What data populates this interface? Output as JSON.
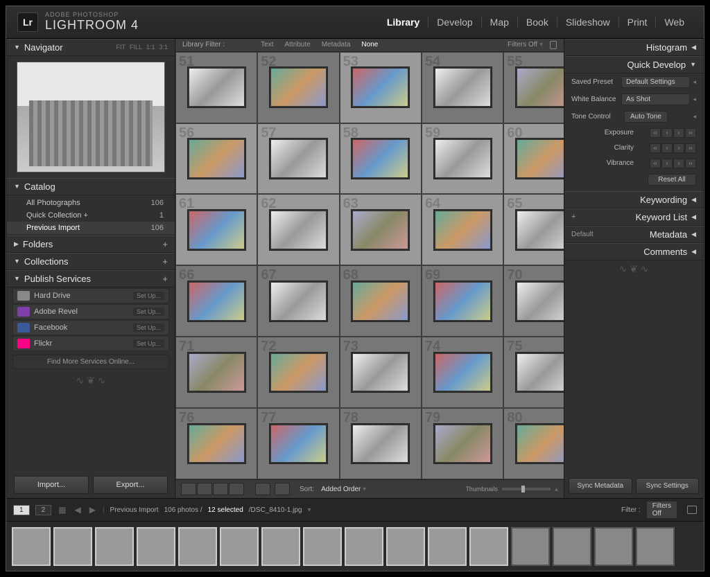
{
  "brand": {
    "logo": "Lr",
    "small": "ADOBE PHOTOSHOP",
    "big": "LIGHTROOM 4"
  },
  "modules": [
    "Library",
    "Develop",
    "Map",
    "Book",
    "Slideshow",
    "Print",
    "Web"
  ],
  "active_module": "Library",
  "navigator": {
    "title": "Navigator",
    "opts": [
      "FIT",
      "FILL",
      "1:1",
      "3:1"
    ]
  },
  "catalog": {
    "title": "Catalog",
    "items": [
      {
        "label": "All Photographs",
        "count": "106"
      },
      {
        "label": "Quick Collection  +",
        "count": "1"
      },
      {
        "label": "Previous Import",
        "count": "106"
      }
    ],
    "selected": 2
  },
  "folders": {
    "title": "Folders"
  },
  "collections": {
    "title": "Collections"
  },
  "publish": {
    "title": "Publish Services",
    "items": [
      {
        "label": "Hard Drive",
        "color": "#888",
        "setup": "Set Up..."
      },
      {
        "label": "Adobe Revel",
        "color": "#7e3fa8",
        "setup": "Set Up..."
      },
      {
        "label": "Facebook",
        "color": "#3b5998",
        "setup": "Set Up..."
      },
      {
        "label": "Flickr",
        "color": "#ff0084",
        "setup": "Set Up..."
      }
    ],
    "findmore": "Find More Services Online..."
  },
  "left_buttons": {
    "import": "Import...",
    "export": "Export..."
  },
  "filterbar": {
    "label": "Library Filter :",
    "tabs": [
      "Text",
      "Attribute",
      "Metadata",
      "None"
    ],
    "active": "None",
    "off": "Filters Off"
  },
  "grid": {
    "start": 51,
    "count": 30,
    "selected": [
      53,
      56,
      57,
      58,
      59,
      60,
      61,
      62,
      63,
      64,
      65
    ]
  },
  "toolbar": {
    "sort_label": "Sort:",
    "sort_value": "Added Order",
    "thumbs_label": "Thumbnails"
  },
  "right": {
    "histogram": "Histogram",
    "quickdev": {
      "title": "Quick Develop",
      "saved_preset": {
        "label": "Saved Preset",
        "value": "Default Settings"
      },
      "white_balance": {
        "label": "White Balance",
        "value": "As Shot"
      },
      "tone_control": {
        "label": "Tone Control",
        "button": "Auto Tone"
      },
      "sliders": [
        "Exposure",
        "Clarity",
        "Vibrance"
      ],
      "reset": "Reset All"
    },
    "keywording": "Keywording",
    "keywordlist": "Keyword List",
    "metadata": {
      "title": "Metadata",
      "preset": "Default"
    },
    "comments": "Comments",
    "sync_meta": "Sync Metadata",
    "sync_settings": "Sync Settings"
  },
  "status": {
    "pages": [
      "1",
      "2"
    ],
    "source": "Previous Import",
    "counts": "106 photos /",
    "selected": "12 selected",
    "file": "/DSC_8410-1.jpg",
    "filter_label": "Filter :",
    "filter_value": "Filters Off"
  },
  "filmstrip": {
    "count": 16,
    "selected": [
      1,
      2,
      3,
      4,
      5,
      6,
      7,
      8,
      9,
      10,
      11,
      12
    ]
  }
}
